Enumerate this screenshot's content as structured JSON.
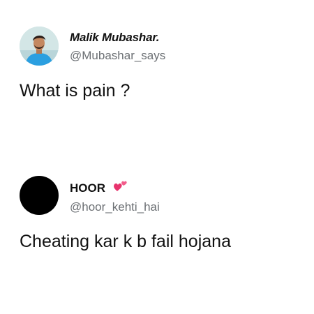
{
  "tweets": [
    {
      "name": "Malik Mubashar.",
      "handle": "@Mubashar_says",
      "text": "What is pain ?",
      "avatar": "profile-photo"
    },
    {
      "name": "HOOR",
      "handle": "@hoor_kehti_hai",
      "text": "Cheating kar k b fail hojana",
      "avatar": "black-circle",
      "name_emoji": "two-hearts-icon"
    }
  ],
  "colors": {
    "text": "#111111",
    "handle": "#6b6f73",
    "heart": "#e8336d",
    "background": "#ffffff"
  }
}
